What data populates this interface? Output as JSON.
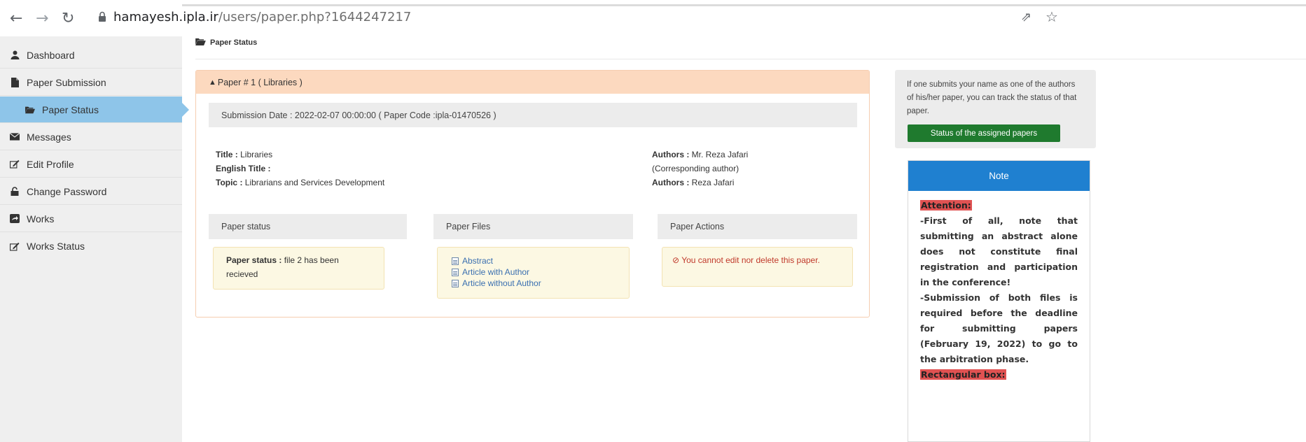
{
  "browser": {
    "url_host": "hamayesh.ipla.ir",
    "url_path": "/users/paper.php?1644247217",
    "back_icon": "arrow-left-icon",
    "forward_icon": "arrow-right-icon",
    "reload_icon": "reload-icon",
    "share_icon": "share-icon",
    "bookmark_icon": "star-icon"
  },
  "sidebar": {
    "items": [
      {
        "label": "Dashboard",
        "icon": "user-icon"
      },
      {
        "label": "Paper Submission",
        "icon": "file-icon"
      },
      {
        "label": "Paper Status",
        "icon": "folder-open-icon",
        "active": true
      },
      {
        "label": "Messages",
        "icon": "envelope-icon"
      },
      {
        "label": "Edit Profile",
        "icon": "edit-icon"
      },
      {
        "label": "Change Password",
        "icon": "lock-icon"
      },
      {
        "label": "Works",
        "icon": "share-square-icon"
      },
      {
        "label": "Works Status",
        "icon": "edit-icon"
      }
    ]
  },
  "breadcrumb": {
    "title": "Paper Status"
  },
  "paper": {
    "header": "Paper # 1 ( Libraries )",
    "submission": "Submission Date : 2022-02-07 00:00:00 ( Paper Code :ipla-01470526 )",
    "title_label": "Title :",
    "title_value": " Libraries",
    "english_title_label": "English Title :",
    "topic_label": "Topic :",
    "topic_value": " Librarians and Services Development",
    "authors_label": "Authors :",
    "authors_value": " Mr. Reza Jafari",
    "corresponding": "(Corresponding author)",
    "authors2_label": "Authors :",
    "authors2_value": "  Reza Jafari",
    "status_head": "Paper status",
    "status_label": "Paper status :",
    "status_value": "  file 2 has been recieved",
    "files_head": "Paper Files",
    "files": [
      "Abstract",
      "Article with Author",
      "Article without Author"
    ],
    "actions_head": "Paper Actions",
    "actions_msg": "You cannot edit nor delete this paper."
  },
  "tracking": {
    "text": "If one submits your name as one of the authors of his/her paper, you can track the status of that paper.",
    "button": "Status of the assigned papers"
  },
  "note": {
    "title": "Note",
    "attention": "Attention:",
    "p1": "-First of all, note that submitting an abstract alone does not constitute final registration and participation in the conference!",
    "p2": "-Submission of both files is required before the deadline for submitting papers (February 19, 2022) to go to the arbitration phase.",
    "rect": "Rectangular box:"
  },
  "colors": {
    "sidebar_bg": "#efefef",
    "active_item": "#8ec5e9",
    "panel_header": "#fcd9bf",
    "status_box": "#fcf8e3",
    "button_green": "#1f7a2e",
    "note_header": "#1f80d0",
    "highlight_red": "#e05252"
  }
}
